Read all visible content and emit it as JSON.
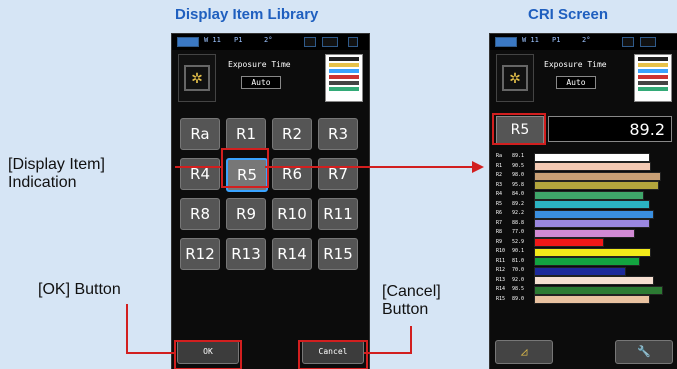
{
  "titles": {
    "library": "Display Item Library",
    "cri": "CRI Screen"
  },
  "status": {
    "ch": "W 11",
    "mode": "P1",
    "deg": "2°"
  },
  "exposure": {
    "label": "Exposure Time",
    "value": "Auto"
  },
  "library_buttons": [
    "Ra",
    "R1",
    "R2",
    "R3",
    "R4",
    "R5",
    "R6",
    "R7",
    "R8",
    "R9",
    "R10",
    "R11",
    "R12",
    "R13",
    "R14",
    "R15"
  ],
  "selected_item": "R5",
  "ok_button": "OK",
  "cancel_button": "Cancel",
  "callouts": {
    "display_item_line1": "[Display Item]",
    "display_item_line2": "Indication",
    "ok_line1": "[OK] Button",
    "cancel_line1": "[Cancel]",
    "cancel_line2": "Button"
  },
  "cri_screen": {
    "selected_label": "R5",
    "selected_value": "89.2",
    "rows": [
      {
        "label": "Ra",
        "value": "89.1",
        "level": 0.89,
        "color": "#ffffff"
      },
      {
        "label": "R1",
        "value": "90.5",
        "level": 0.9,
        "color": "#f3c9b3"
      },
      {
        "label": "R2",
        "value": "98.0",
        "level": 0.98,
        "color": "#c9a075"
      },
      {
        "label": "R3",
        "value": "95.8",
        "level": 0.96,
        "color": "#b2a53d"
      },
      {
        "label": "R4",
        "value": "84.0",
        "level": 0.84,
        "color": "#3fa66a"
      },
      {
        "label": "R5",
        "value": "89.2",
        "level": 0.89,
        "color": "#2bb3c2"
      },
      {
        "label": "R6",
        "value": "92.2",
        "level": 0.92,
        "color": "#3a8fe0"
      },
      {
        "label": "R7",
        "value": "88.8",
        "level": 0.89,
        "color": "#9a87e0"
      },
      {
        "label": "R8",
        "value": "77.0",
        "level": 0.77,
        "color": "#d18ad4"
      },
      {
        "label": "R9",
        "value": "52.9",
        "level": 0.53,
        "color": "#f01818"
      },
      {
        "label": "R10",
        "value": "90.1",
        "level": 0.9,
        "color": "#f2ea1a"
      },
      {
        "label": "R11",
        "value": "81.0",
        "level": 0.81,
        "color": "#13a340"
      },
      {
        "label": "R12",
        "value": "70.0",
        "level": 0.7,
        "color": "#1e2a9a"
      },
      {
        "label": "R13",
        "value": "92.0",
        "level": 0.92,
        "color": "#f7e0d2"
      },
      {
        "label": "R14",
        "value": "98.5",
        "level": 0.99,
        "color": "#2c7a33"
      },
      {
        "label": "R15",
        "value": "89.0",
        "level": 0.89,
        "color": "#e9c2a0"
      }
    ]
  },
  "colors": {
    "highlight": "#d21f1f",
    "selection": "#3aa3ff",
    "title_blue": "#1f5fbf",
    "background": "#d6e5f5"
  },
  "icons": [
    "star-sensor-icon",
    "spectrum-graph-icon",
    "triangle-icon",
    "wrench-icon"
  ]
}
